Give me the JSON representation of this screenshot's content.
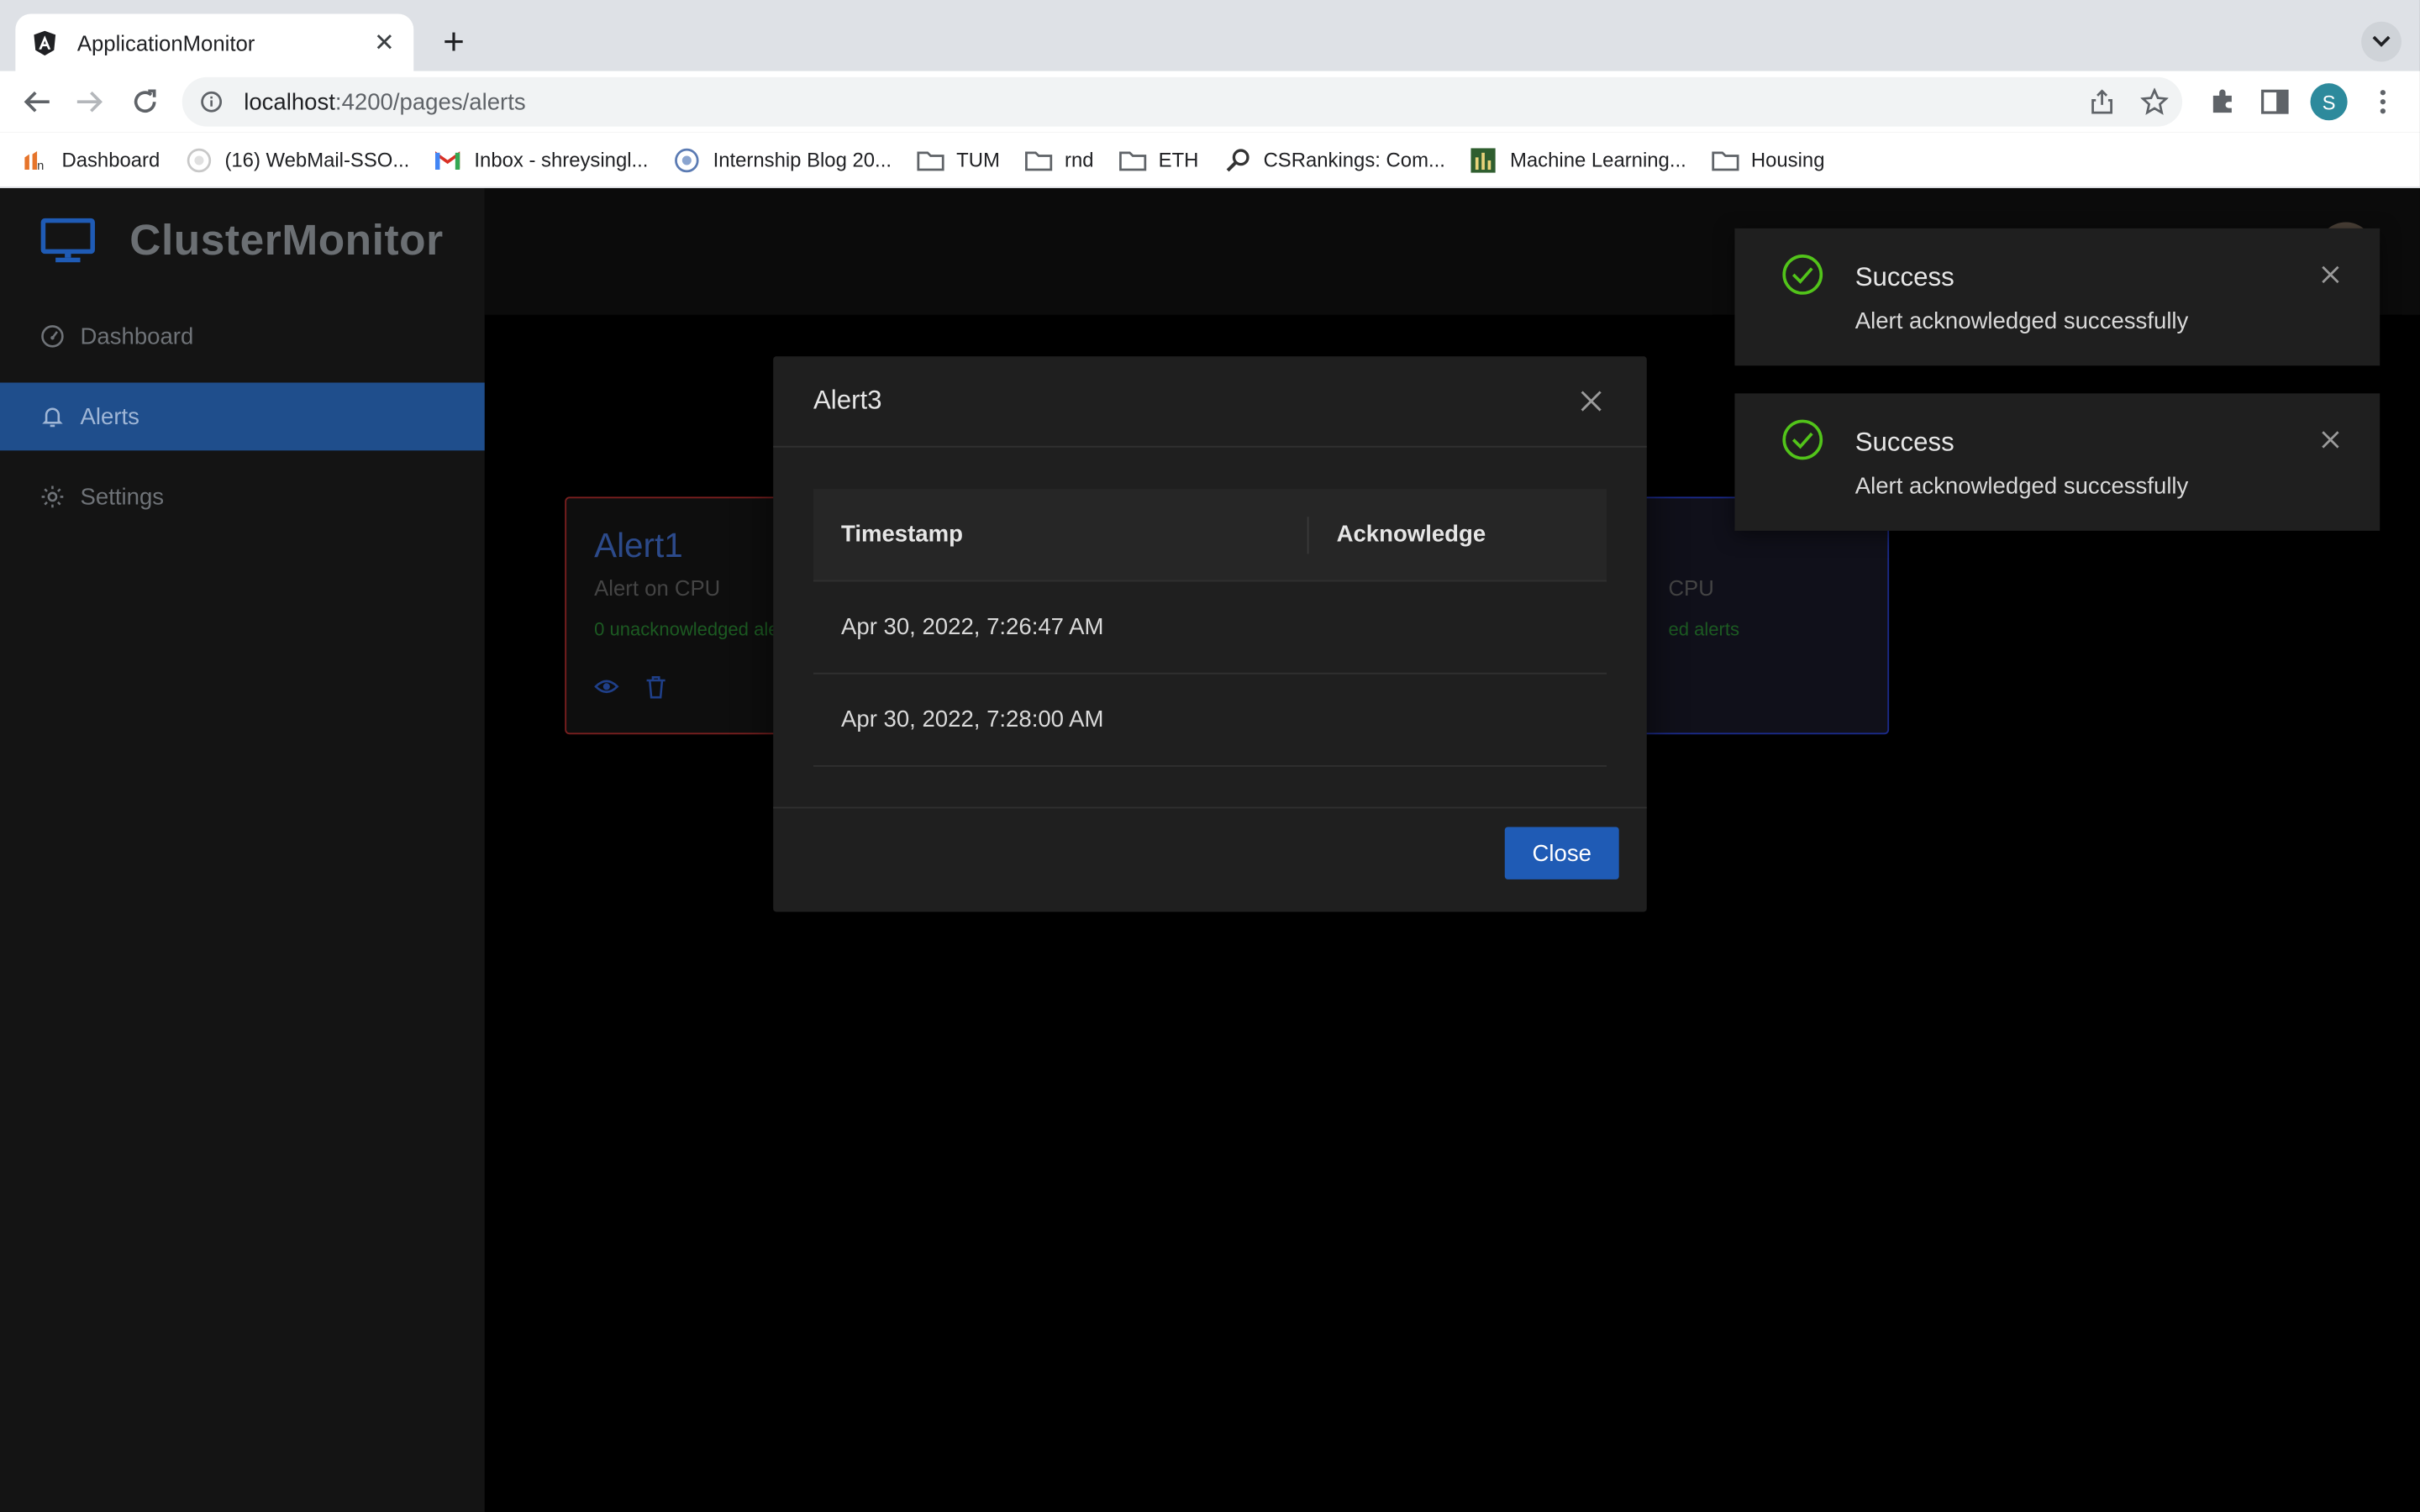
{
  "browser": {
    "tab_title": "ApplicationMonitor",
    "url_host": "localhost",
    "url_path": ":4200/pages/alerts",
    "profile_initial": "S",
    "bookmarks": [
      {
        "label": "Dashboard",
        "icon": "dashboard-favicon-icon"
      },
      {
        "label": "(16) WebMail-SSO...",
        "icon": "webmail-favicon-icon"
      },
      {
        "label": "Inbox - shreysingl...",
        "icon": "gmail-icon"
      },
      {
        "label": "Internship Blog 20...",
        "icon": "blog-favicon-icon"
      },
      {
        "label": "TUM",
        "icon": "folder-icon"
      },
      {
        "label": "rnd",
        "icon": "folder-icon"
      },
      {
        "label": "ETH",
        "icon": "folder-icon"
      },
      {
        "label": "CSRankings: Com...",
        "icon": "search-favicon-icon"
      },
      {
        "label": "Machine Learning...",
        "icon": "ml-favicon-icon"
      },
      {
        "label": "Housing",
        "icon": "folder-icon"
      }
    ]
  },
  "app": {
    "brand": "ClusterMonitor",
    "sidebar": [
      {
        "label": "Dashboard",
        "icon": "dashboard-icon",
        "active": false
      },
      {
        "label": "Alerts",
        "icon": "bell-icon",
        "active": true
      },
      {
        "label": "Settings",
        "icon": "gear-icon",
        "active": false
      }
    ],
    "cards": [
      {
        "title": "Alert1",
        "subtitle": "Alert on CPU",
        "count": "0 unacknowledged alerts"
      },
      {
        "subtitle": "CPU",
        "count": "ed alerts"
      }
    ]
  },
  "modal": {
    "title": "Alert3",
    "columns": [
      "Timestamp",
      "Acknowledge"
    ],
    "rows": [
      {
        "timestamp": "Apr 30, 2022, 7:26:47 AM"
      },
      {
        "timestamp": "Apr 30, 2022, 7:28:00 AM"
      }
    ],
    "close_label": "Close"
  },
  "toasts": [
    {
      "title": "Success",
      "message": "Alert acknowledged successfully"
    },
    {
      "title": "Success",
      "message": "Alert acknowledged successfully"
    }
  ],
  "colors": {
    "accent": "#1f5bb5",
    "sidebar_active": "#1f4e8c",
    "success": "#52c41a"
  }
}
